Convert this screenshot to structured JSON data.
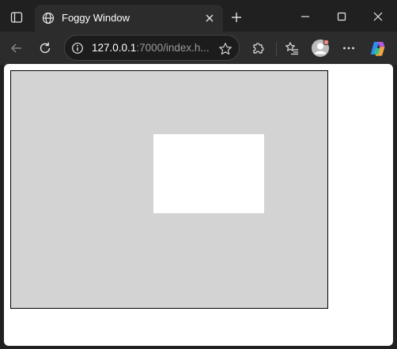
{
  "browser": {
    "tab": {
      "title": "Foggy Window",
      "favicon": "globe-icon"
    },
    "address": {
      "host": "127.0.0.1",
      "path": ":7000/index.h..."
    },
    "toolbar_icons": [
      "back-arrow-icon",
      "refresh-icon",
      "site-info-icon",
      "favorite-star-icon",
      "extensions-puzzle-icon",
      "favorites-list-icon",
      "profile-avatar-icon",
      "more-options-icon",
      "copilot-icon"
    ],
    "window_controls": [
      "minimize-icon",
      "maximize-icon",
      "close-icon"
    ]
  },
  "page": {
    "canvas": {
      "fog_color": "#d3d3d3",
      "border_color": "#000000",
      "clear_area_color": "#ffffff"
    }
  },
  "theme": {
    "chrome_bg": "#202020",
    "toolbar_bg": "#2c2c2c",
    "page_bg": "#ffffff"
  }
}
